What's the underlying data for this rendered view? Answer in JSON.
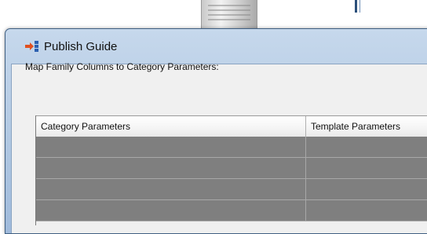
{
  "dialog": {
    "title": "Publish Guide",
    "icon": "publish-arrow-icon"
  },
  "content": {
    "instruction": "Map Family Columns to Category Parameters:"
  },
  "table": {
    "columns": [
      {
        "label": "Category Parameters"
      },
      {
        "label": "Template Parameters"
      }
    ],
    "rows": [
      {
        "category": "",
        "template": ""
      },
      {
        "category": "",
        "template": ""
      },
      {
        "category": "",
        "template": ""
      },
      {
        "category": "",
        "template": ""
      }
    ],
    "row_color": "#7f7f7f"
  },
  "colors": {
    "title_bar": "#b5cbe4",
    "client_background": "#f0f0f0",
    "icon_accent": "#e05020"
  }
}
